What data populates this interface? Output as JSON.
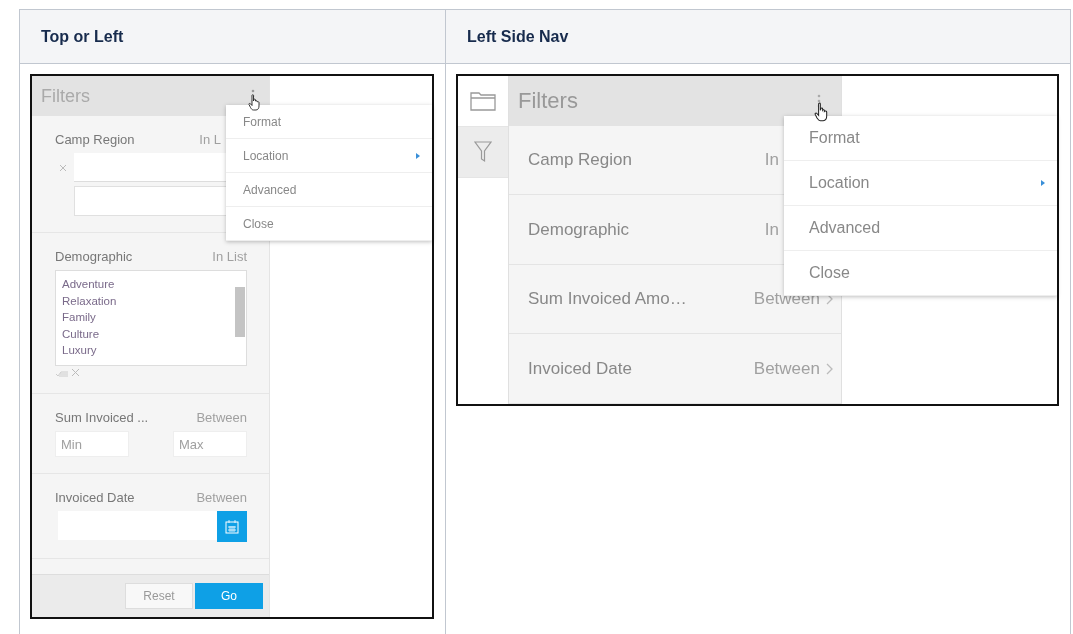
{
  "table": {
    "columns": [
      "Top or Left",
      "Left Side Nav"
    ]
  },
  "top_or_left": {
    "panel_title": "Filters",
    "filters": [
      {
        "kind": "text-list",
        "label": "Camp Region",
        "operator": "In L"
      },
      {
        "kind": "list",
        "label": "Demographic",
        "operator": "In List",
        "options": [
          "Adventure",
          "Relaxation",
          "Family",
          "Culture",
          "Luxury"
        ]
      },
      {
        "kind": "range",
        "label": "Sum Invoiced ...",
        "operator": "Between",
        "min_placeholder": "Min",
        "max_placeholder": "Max"
      },
      {
        "kind": "date",
        "label": "Invoiced Date",
        "operator": "Between"
      }
    ],
    "menu": [
      {
        "label": "Format",
        "submenu": false
      },
      {
        "label": "Location",
        "submenu": true
      },
      {
        "label": "Advanced",
        "submenu": false
      },
      {
        "label": "Close",
        "submenu": false
      }
    ],
    "buttons": [
      {
        "label": "Reset",
        "primary": false
      },
      {
        "label": "Go",
        "primary": true
      }
    ]
  },
  "left_side_nav": {
    "nav": [
      {
        "kind": "folder",
        "selected": false
      },
      {
        "kind": "funnel",
        "selected": true
      }
    ],
    "panel_title": "Filters",
    "filters": [
      {
        "label": "Camp Region",
        "operator": "In",
        "chevron": false
      },
      {
        "label": "Demographic",
        "operator": "In",
        "chevron": false
      },
      {
        "label": "Sum Invoiced Amo…",
        "operator": "Between",
        "chevron": true
      },
      {
        "label": "Invoiced Date",
        "operator": "Between",
        "chevron": true
      }
    ],
    "menu": [
      {
        "label": "Format",
        "submenu": false
      },
      {
        "label": "Location",
        "submenu": true
      },
      {
        "label": "Advanced",
        "submenu": false
      },
      {
        "label": "Close",
        "submenu": false
      }
    ]
  }
}
